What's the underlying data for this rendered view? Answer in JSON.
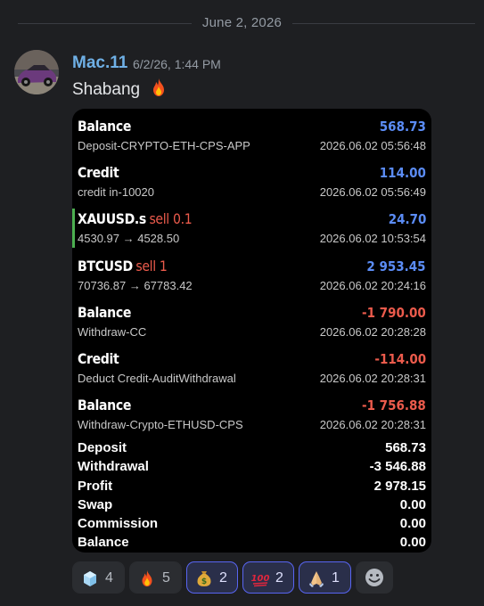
{
  "divider": {
    "date": "June 2, 2026"
  },
  "message": {
    "author": "Mac.11",
    "timestamp": "6/2/26, 1:44 PM",
    "text": "Shabang"
  },
  "embed": {
    "rows": [
      {
        "title": "Balance",
        "tag": "",
        "amount": "568.73",
        "sign": "pos",
        "sub": "Deposit-CRYPTO-ETH-CPS-APP",
        "time": "2026.06.02 05:56:48"
      },
      {
        "title": "Credit",
        "tag": "",
        "amount": "114.00",
        "sign": "pos",
        "sub": "credit in-10020",
        "time": "2026.06.02 05:56:49"
      },
      {
        "title": "XAUUSD.s",
        "tag": "sell 0.1",
        "amount": "24.70",
        "sign": "pos",
        "sub": "4530.97 → 4528.50",
        "time": "2026.06.02 10:53:54"
      },
      {
        "title": "BTCUSD",
        "tag": "sell 1",
        "amount": "2 953.45",
        "sign": "pos",
        "sub": "70736.87 → 67783.42",
        "time": "2026.06.02 20:24:16"
      },
      {
        "title": "Balance",
        "tag": "",
        "amount": "-1 790.00",
        "sign": "neg",
        "sub": "Withdraw-CC",
        "time": "2026.06.02 20:28:28"
      },
      {
        "title": "Credit",
        "tag": "",
        "amount": "-114.00",
        "sign": "neg",
        "sub": "Deduct Credit-AuditWithdrawal",
        "time": "2026.06.02 20:28:31"
      },
      {
        "title": "Balance",
        "tag": "",
        "amount": "-1 756.88",
        "sign": "neg",
        "sub": "Withdraw-Crypto-ETHUSD-CPS",
        "time": "2026.06.02 20:28:31"
      }
    ],
    "summary": [
      {
        "label": "Deposit",
        "value": "568.73"
      },
      {
        "label": "Withdrawal",
        "value": "-3 546.88"
      },
      {
        "label": "Profit",
        "value": "2 978.15"
      },
      {
        "label": "Swap",
        "value": "0.00"
      },
      {
        "label": "Commission",
        "value": "0.00"
      },
      {
        "label": "Balance",
        "value": "0.00"
      }
    ]
  },
  "reactions": [
    {
      "icon": "ice-cube-icon",
      "count": "4",
      "mine": false
    },
    {
      "icon": "fire-icon",
      "count": "5",
      "mine": false
    },
    {
      "icon": "money-bag-icon",
      "count": "2",
      "mine": true
    },
    {
      "icon": "hundred-points-icon",
      "count": "2",
      "mine": true
    },
    {
      "icon": "folded-hands-icon",
      "count": "1",
      "mine": true
    }
  ],
  "colors": {
    "positive": "#5b8cf5",
    "negative": "#ec5b4c",
    "author": "#6fb0e6",
    "highlight_bar": "#4caf50"
  }
}
